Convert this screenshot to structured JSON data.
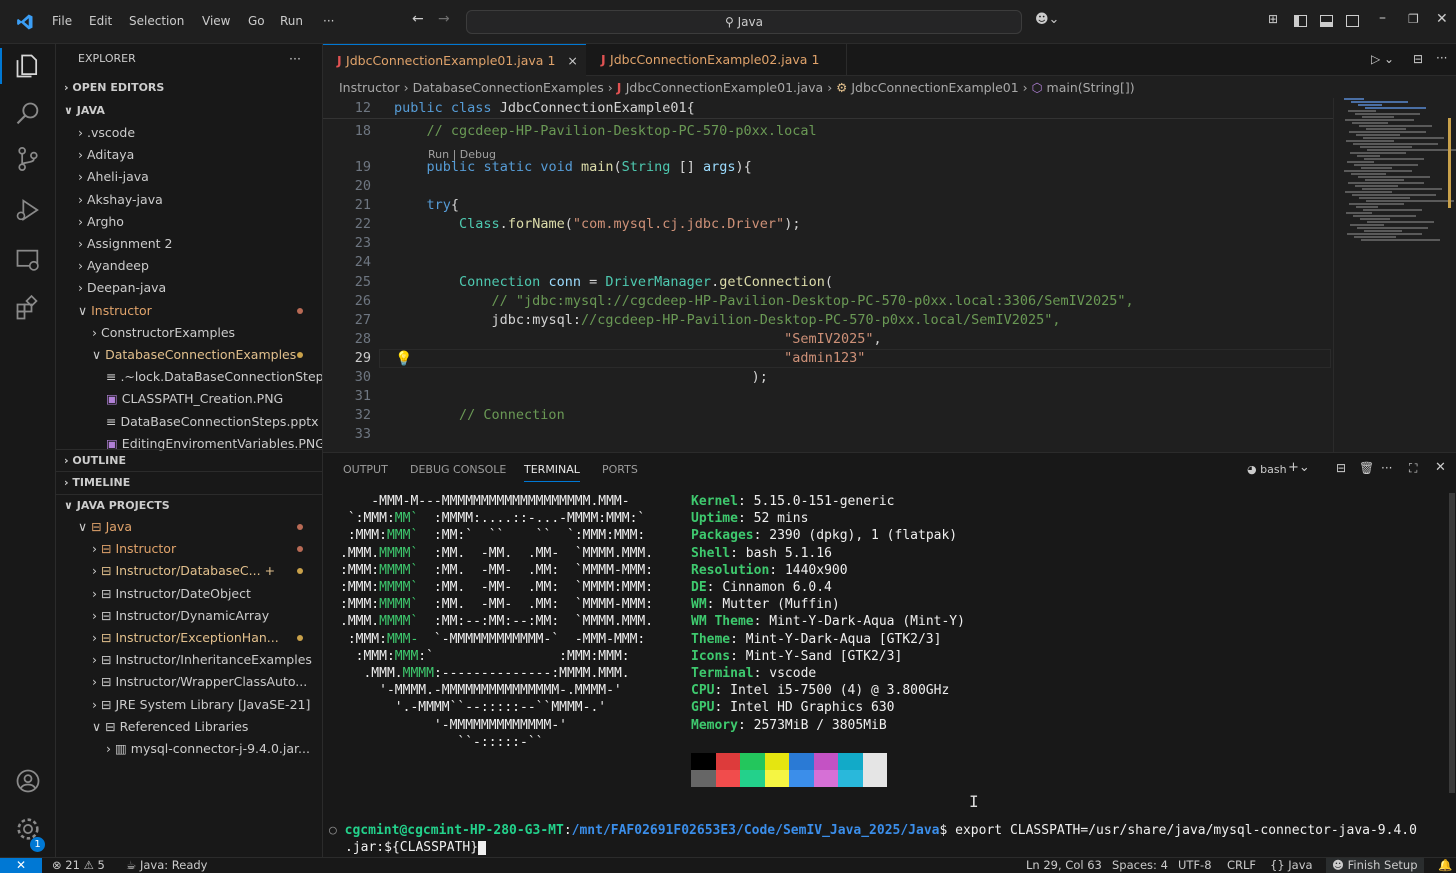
{
  "titlebar": {
    "menu": [
      "File",
      "Edit",
      "Selection",
      "View",
      "Go",
      "Run",
      "···"
    ],
    "search": "Java"
  },
  "sidebar": {
    "title": "EXPLORER",
    "more": "···",
    "open_editors": "OPEN EDITORS",
    "root": "JAVA",
    "tree": [
      {
        "label": ".vscode",
        "indent": 1,
        "arrow": ">"
      },
      {
        "label": "Aditaya",
        "indent": 1,
        "arrow": ">"
      },
      {
        "label": "Aheli-java",
        "indent": 1,
        "arrow": ">"
      },
      {
        "label": "Akshay-java",
        "indent": 1,
        "arrow": ">"
      },
      {
        "label": "Argho",
        "indent": 1,
        "arrow": ">"
      },
      {
        "label": "Assignment 2",
        "indent": 1,
        "arrow": ">"
      },
      {
        "label": "Ayandeep",
        "indent": 1,
        "arrow": ">"
      },
      {
        "label": "Deepan-java",
        "indent": 1,
        "arrow": ">"
      },
      {
        "label": "Instructor",
        "indent": 1,
        "arrow": "∨",
        "status": "mod"
      },
      {
        "label": "ConstructorExamples",
        "indent": 2,
        "arrow": ">"
      },
      {
        "label": "DatabaseConnectionExamples",
        "indent": 2,
        "arrow": "∨",
        "status": "modY"
      },
      {
        "label": ".~lock.DataBaseConnectionSteps....",
        "indent": 3,
        "icon": "≡"
      },
      {
        "label": "CLASSPATH_Creation.PNG",
        "indent": 3,
        "icon": "▣"
      },
      {
        "label": "DataBaseConnectionSteps.pptx",
        "indent": 3,
        "icon": "≡"
      },
      {
        "label": "EditingEnviromentVariables.PNG",
        "indent": 3,
        "icon": "▣"
      }
    ],
    "outline": "OUTLINE",
    "timeline": "TIMELINE",
    "java_projects": "JAVA PROJECTS",
    "projects": [
      {
        "label": "Java",
        "indent": 1,
        "arrow": "∨",
        "status": "mod"
      },
      {
        "label": "Instructor",
        "indent": 2,
        "arrow": ">",
        "status": "mod"
      },
      {
        "label": "Instructor/DatabaseC...",
        "indent": 2,
        "arrow": ">",
        "status": "modY",
        "plus": "+"
      },
      {
        "label": "Instructor/DateObject",
        "indent": 2,
        "arrow": ">"
      },
      {
        "label": "Instructor/DynamicArray",
        "indent": 2,
        "arrow": ">"
      },
      {
        "label": "Instructor/ExceptionHan...",
        "indent": 2,
        "arrow": ">",
        "status": "modY"
      },
      {
        "label": "Instructor/InheritanceExamples",
        "indent": 2,
        "arrow": ">"
      },
      {
        "label": "Instructor/WrapperClassAuto...",
        "indent": 2,
        "arrow": ">"
      },
      {
        "label": "JRE System Library [JavaSE-21]",
        "indent": 2,
        "arrow": ">"
      },
      {
        "label": "Referenced Libraries",
        "indent": 2,
        "arrow": "∨"
      },
      {
        "label": "mysql-connector-j-9.4.0.jar...",
        "indent": 3,
        "arrow": ">"
      }
    ]
  },
  "tabs": [
    {
      "label": "JdbcConnectionExample01.java",
      "badge": "1",
      "close": "×",
      "active": true
    },
    {
      "label": "JdbcConnectionExample02.java",
      "badge": "1",
      "active": false
    }
  ],
  "breadcrumbs": [
    "Instructor",
    "DatabaseConnectionExamples",
    "JdbcConnectionExample01.java",
    "JdbcConnectionExample01",
    "main(String[])"
  ],
  "editor": {
    "codelens": "Run | Debug",
    "lines": [
      {
        "n": "12",
        "text": "public class JdbcConnectionExample01{"
      },
      {
        "n": "18",
        "text": "    // cgcdeep-HP-Pavilion-Desktop-PC-570-p0xx.local"
      },
      {
        "n": "19",
        "text": "    public static void main(String [] args){"
      },
      {
        "n": "20",
        "text": ""
      },
      {
        "n": "21",
        "text": "    try{"
      },
      {
        "n": "22",
        "text": "        Class.forName(\"com.mysql.cj.jdbc.Driver\");"
      },
      {
        "n": "23",
        "text": ""
      },
      {
        "n": "24",
        "text": ""
      },
      {
        "n": "25",
        "text": "        Connection conn = DriverManager.getConnection("
      },
      {
        "n": "26",
        "text": "            // \"jdbc:mysql://cgcdeep-HP-Pavilion-Desktop-PC-570-p0xx.local:3306/SemIV2025\","
      },
      {
        "n": "27",
        "text": "            \"jdbc:mysql://cgcdeep-HP-Pavilion-Desktop-PC-570-p0xx.local/SemIV2025\","
      },
      {
        "n": "28",
        "text": "                                                \"SemIV2025\","
      },
      {
        "n": "29",
        "text": "                                                \"admin123\""
      },
      {
        "n": "30",
        "text": "                                            );"
      },
      {
        "n": "31",
        "text": ""
      },
      {
        "n": "32",
        "text": "        // Connection"
      },
      {
        "n": "33",
        "text": ""
      }
    ]
  },
  "panel": {
    "tabs": [
      "OUTPUT",
      "DEBUG CONSOLE",
      "TERMINAL",
      "PORTS"
    ],
    "active": "TERMINAL",
    "shell": "bash",
    "logo": [
      "    -MMM-M---MMMMMMMMMMMMMMMMMMM.MMM-",
      " `:MMM:MM`  :MMMM:....::-...-MMMM:MMM:`",
      " :MMM:MMM`  :MM:`  ``    ``  `:MMM:MMM:",
      ".MMM.MMMM`  :MM.  -MM.  .MM-  `MMMM.MMM.",
      ":MMM:MMMM`  :MM.  -MM-  .MM:  `MMMM-MMM:",
      ":MMM:MMMM`  :MM.  -MM-  .MM:  `MMMM:MMM:",
      ":MMM:MMMM`  :MM.  -MM-  .MM:  `MMMM-MMM:",
      ".MMM.MMMM`  :MM:--:MM:--:MM:  `MMMM.MMM.",
      " :MMM:MMM-  `-MMMMMMMMMMMM-`  -MMM-MMM:",
      "  :MMM:MMM:`                :MMM:MMM:",
      "   .MMM.MMMM:--------------:MMMM.MMM.",
      "     '-MMMM.-MMMMMMMMMMMMMMM-.MMMM-'",
      "       '.-MMMM``--:::::--``MMMM-.'",
      "            '-MMMMMMMMMMMMM-'",
      "               ``-:::::-``"
    ],
    "info": [
      {
        "k": "Kernel",
        "v": "5.15.0-151-generic"
      },
      {
        "k": "Uptime",
        "v": "52 mins"
      },
      {
        "k": "Packages",
        "v": "2390 (dpkg), 1 (flatpak)"
      },
      {
        "k": "Shell",
        "v": "bash 5.1.16"
      },
      {
        "k": "Resolution",
        "v": "1440x900"
      },
      {
        "k": "DE",
        "v": "Cinnamon 6.0.4"
      },
      {
        "k": "WM",
        "v": "Mutter (Muffin)"
      },
      {
        "k": "WM Theme",
        "v": "Mint-Y-Dark-Aqua (Mint-Y)"
      },
      {
        "k": "Theme",
        "v": "Mint-Y-Dark-Aqua [GTK2/3]"
      },
      {
        "k": "Icons",
        "v": "Mint-Y-Sand [GTK2/3]"
      },
      {
        "k": "Terminal",
        "v": "vscode"
      },
      {
        "k": "CPU",
        "v": "Intel i5-7500 (4) @ 3.800GHz"
      },
      {
        "k": "GPU",
        "v": "Intel HD Graphics 630"
      },
      {
        "k": "Memory",
        "v": "2573MiB / 3805MiB"
      }
    ],
    "palette_top": [
      "#000000",
      "#dd3b3b",
      "#23c65c",
      "#e5e510",
      "#2a7ad5",
      "#c452c4",
      "#12aac8",
      "#e5e5e5"
    ],
    "palette_bottom": [
      "#666666",
      "#f14c4c",
      "#23d18b",
      "#f5f543",
      "#3b8eea",
      "#d670d6",
      "#29b8db",
      "#e5e5e5"
    ],
    "prompt_user": "cgcmint@cgcmint-HP-280-G3-MT",
    "prompt_path": "/mnt/FAF02691F02653E3/Code/SemIV_Java_2025/Java",
    "command": "$ export CLASSPATH=/usr/share/java/mysql-connector-java-9.4.0",
    "command_cont": ".jar:${CLASSPATH}"
  },
  "status": {
    "errors": "⊗ 21",
    "warnings": "⚠ 5",
    "java": "Java: Ready",
    "position": "Ln 29, Col 63",
    "spaces": "Spaces: 4",
    "encoding": "UTF-8",
    "eol": "CRLF",
    "language": "{} Java",
    "setup": "Finish Setup"
  },
  "colors": {
    "accent": "#0078d4",
    "modified": "#e0a36b",
    "terminal_green": "#3ec96e"
  }
}
